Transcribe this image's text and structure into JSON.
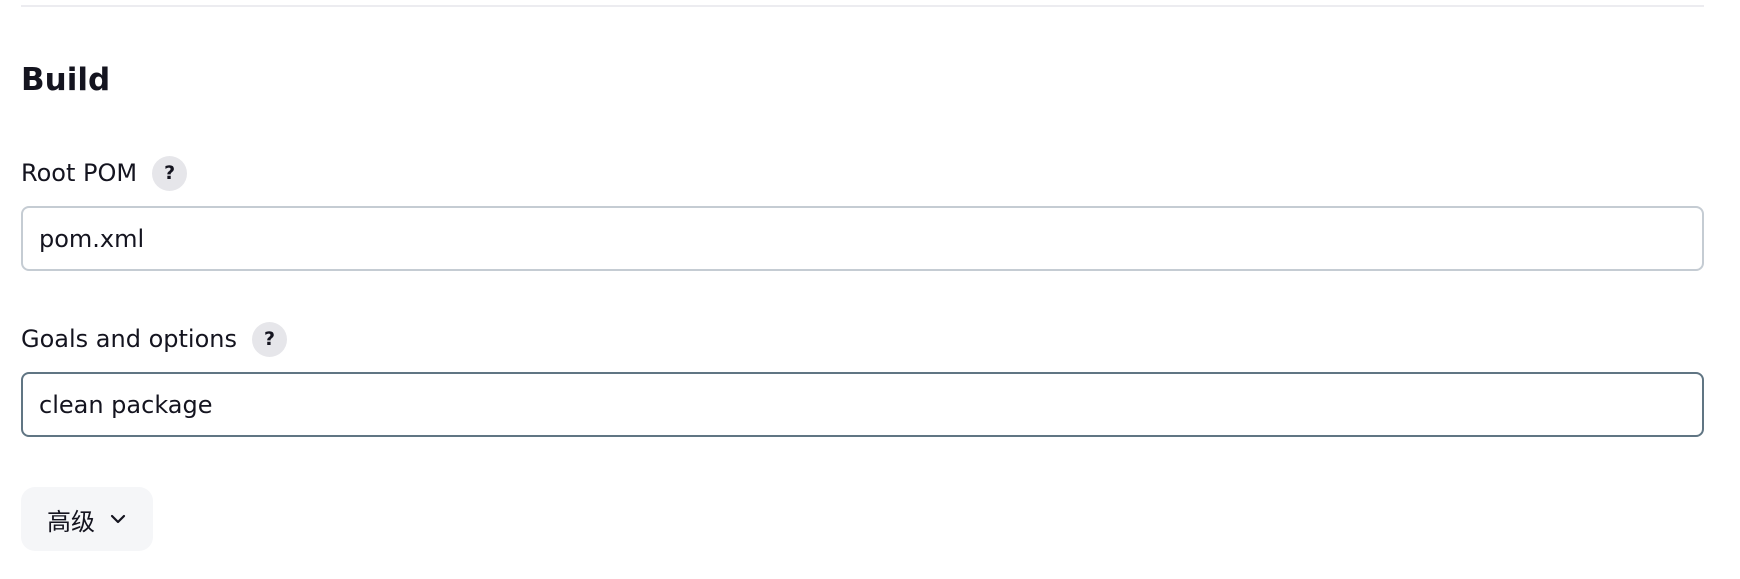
{
  "section": {
    "title": "Build"
  },
  "fields": {
    "root_pom": {
      "label": "Root POM",
      "help_text": "?",
      "value": "pom.xml"
    },
    "goals": {
      "label": "Goals and options",
      "help_text": "?",
      "value": "clean package"
    }
  },
  "advanced": {
    "label": "高级",
    "icon": "chevron-down-icon"
  }
}
